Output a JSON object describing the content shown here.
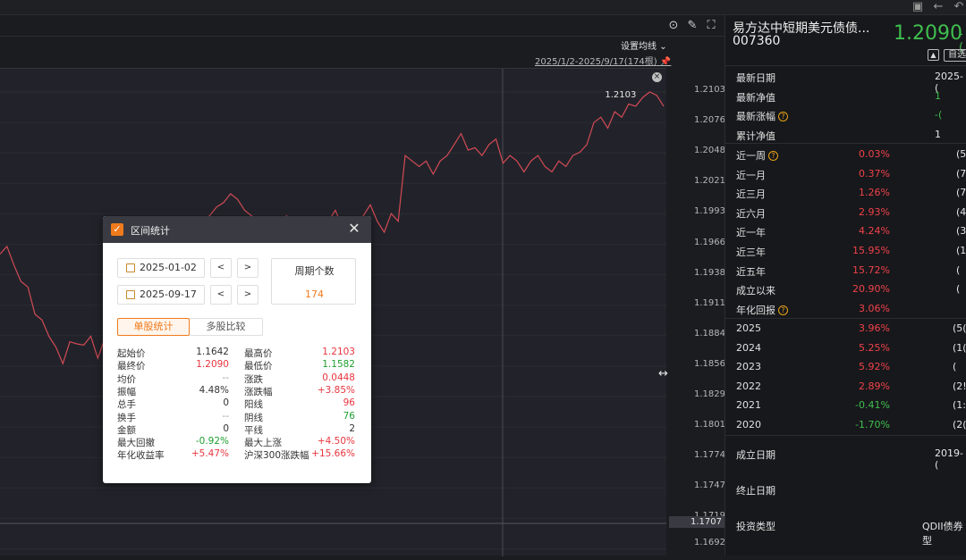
{
  "fund": {
    "name": "易方达中短期美元债债...",
    "code": "007360",
    "nav_big": "1.2090",
    "nav_suffix": "-(",
    "watch_btn": "自选"
  },
  "toolbar": {
    "setting_ma": "设置均线",
    "range_text": "2025/1/2-2025/9/17(174根)"
  },
  "chart_data": {
    "type": "line",
    "y_ticks": [
      "1.2103",
      "1.2076",
      "1.2048",
      "1.2021",
      "1.1993",
      "1.1966",
      "1.1938",
      "1.1911",
      "1.1884",
      "1.1856",
      "1.1829",
      "1.1801",
      "1.1774",
      "1.1747",
      "1.1719",
      "1.1692"
    ],
    "current_label": "1.1707",
    "max_label": "1.2103",
    "ylim": [
      1.1692,
      1.2103
    ],
    "values": [
      1.1955,
      1.1962,
      1.1945,
      1.193,
      1.1925,
      1.19,
      1.1895,
      1.188,
      1.187,
      1.1855,
      1.1875,
      1.1873,
      1.1872,
      1.188,
      1.186,
      1.1878,
      1.187,
      1.1868,
      1.189,
      1.1888,
      1.1895,
      1.1905,
      1.1918,
      1.1925,
      1.1932,
      1.195,
      1.196,
      1.1975,
      1.1965,
      1.1985,
      1.199,
      1.1998,
      1.2002,
      1.201,
      1.2005,
      1.1995,
      1.199,
      1.1985,
      1.198,
      1.197,
      1.1975,
      1.199,
      1.1985,
      1.197,
      1.1985,
      1.1965,
      1.1972,
      1.1985,
      1.1995,
      1.198,
      1.197,
      1.1975,
      1.199,
      1.2,
      1.1985,
      1.1975,
      1.1992,
      1.1985,
      1.2045,
      1.204,
      1.2035,
      1.204,
      1.2028,
      1.204,
      1.2045,
      1.2055,
      1.2065,
      1.205,
      1.2052,
      1.2045,
      1.2055,
      1.206,
      1.2038,
      1.2045,
      1.204,
      1.203,
      1.204,
      1.2045,
      1.2035,
      1.203,
      1.204,
      1.2035,
      1.2045,
      1.2048,
      1.2055,
      1.2075,
      1.208,
      1.207,
      1.2085,
      1.208,
      1.2092,
      1.209,
      1.2098,
      1.2103,
      1.21,
      1.209
    ]
  },
  "dialog": {
    "title": "区间统计",
    "start_date": "2025-01-02",
    "end_date": "2025-09-17",
    "prev": "<",
    "next": ">",
    "period_label": "周期个数",
    "period_value": "174",
    "tab_single": "单股统计",
    "tab_multi": "多股比较",
    "stats_left": [
      {
        "label": "起始价",
        "value": "1.1642",
        "tone": "dk"
      },
      {
        "label": "最终价",
        "value": "1.2090",
        "tone": "dred"
      },
      {
        "label": "均价",
        "value": "--",
        "tone": "dgray"
      },
      {
        "label": "振幅",
        "value": "4.48%",
        "tone": "dk"
      },
      {
        "label": "总手",
        "value": "0",
        "tone": "dk"
      },
      {
        "label": "换手",
        "value": "--",
        "tone": "dgray"
      },
      {
        "label": "金额",
        "value": "0",
        "tone": "dk"
      },
      {
        "label": "最大回撤",
        "value": "-0.92%",
        "tone": "dgreen"
      },
      {
        "label": "年化收益率",
        "value": "+5.47%",
        "tone": "dred"
      }
    ],
    "stats_right": [
      {
        "label": "最高价",
        "value": "1.2103",
        "tone": "dred"
      },
      {
        "label": "最低价",
        "value": "1.1582",
        "tone": "dgreen"
      },
      {
        "label": "涨跌",
        "value": "0.0448",
        "tone": "dred"
      },
      {
        "label": "涨跌幅",
        "value": "+3.85%",
        "tone": "dred"
      },
      {
        "label": "阳线",
        "value": "96",
        "tone": "dred"
      },
      {
        "label": "阴线",
        "value": "76",
        "tone": "dgreen"
      },
      {
        "label": "平线",
        "value": "2",
        "tone": "dk"
      },
      {
        "label": "最大上涨",
        "value": "+4.50%",
        "tone": "dred"
      },
      {
        "label": "沪深300涨跌幅",
        "value": "+15.66%",
        "tone": "dred"
      }
    ]
  },
  "info": {
    "rows_top": [
      {
        "label": "最新日期",
        "value": "2025-(",
        "tone": "white"
      },
      {
        "label": "最新净值",
        "value": "1",
        "tone": "green"
      },
      {
        "label": "最新涨幅",
        "value": "-(",
        "tone": "green",
        "help": true
      },
      {
        "label": "累计净值",
        "value": "1",
        "tone": "white"
      }
    ],
    "perf": [
      {
        "label": "近一周",
        "pct": "0.03%",
        "rank": "(5",
        "help": true
      },
      {
        "label": "近一月",
        "pct": "0.37%",
        "rank": "(7"
      },
      {
        "label": "近三月",
        "pct": "1.26%",
        "rank": "(7"
      },
      {
        "label": "近六月",
        "pct": "2.93%",
        "rank": "(4"
      },
      {
        "label": "近一年",
        "pct": "4.24%",
        "rank": "(3"
      },
      {
        "label": "近三年",
        "pct": "15.95%",
        "rank": "(1"
      },
      {
        "label": "近五年",
        "pct": "15.72%",
        "rank": "("
      },
      {
        "label": "成立以来",
        "pct": "20.90%",
        "rank": "("
      },
      {
        "label": "年化回报",
        "pct": "3.06%",
        "rank": "",
        "help": true
      }
    ],
    "years": [
      {
        "label": "2025",
        "pct": "3.96%",
        "tone": "red",
        "rank": "(5("
      },
      {
        "label": "2024",
        "pct": "5.25%",
        "tone": "red",
        "rank": "(1("
      },
      {
        "label": "2023",
        "pct": "5.92%",
        "tone": "red",
        "rank": "("
      },
      {
        "label": "2022",
        "pct": "2.89%",
        "tone": "red",
        "rank": "(2!"
      },
      {
        "label": "2021",
        "pct": "-0.41%",
        "tone": "green",
        "rank": "(1:"
      },
      {
        "label": "2020",
        "pct": "-1.70%",
        "tone": "green",
        "rank": "(2("
      }
    ],
    "establish_label": "成立日期",
    "establish_value": "2019-(",
    "end_label": "终止日期",
    "type_label": "投资类型",
    "type_value": "QDII债券型"
  }
}
